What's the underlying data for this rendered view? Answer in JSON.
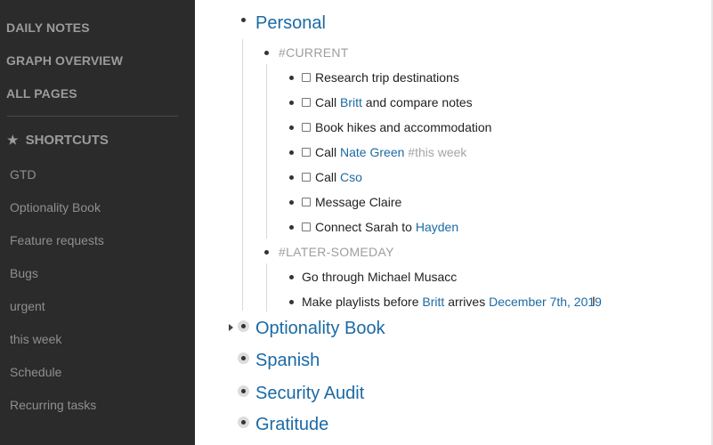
{
  "sidebar": {
    "nav": [
      "DAILY NOTES",
      "GRAPH OVERVIEW",
      "ALL PAGES"
    ],
    "shortcuts_label": "SHORTCUTS",
    "shortcuts": [
      "GTD",
      "Optionality Book",
      "Feature requests",
      "Bugs",
      "urgent",
      "this week",
      "Schedule",
      "Recurring tasks"
    ]
  },
  "outline": {
    "personal": "Personal",
    "current_tag": "#CURRENT",
    "tasks": {
      "t1": "Research trip destinations",
      "t2_pre": "Call",
      "t2_link": "Britt",
      "t2_post": "and compare notes",
      "t3": "Book hikes and accommodation",
      "t4_pre": "Call",
      "t4_link": "Nate Green",
      "t4_tag": "#this week",
      "t5_pre": "Call",
      "t5_link": "Cso",
      "t6": "Message Claire",
      "t7_pre": "Connect Sarah to",
      "t7_link": "Hayden"
    },
    "later_tag": "#LATER-SOMEDAY",
    "later": {
      "l1": "Go through Michael Musacc",
      "l2_pre": "Make playlists before",
      "l2_link": "Britt",
      "l2_mid": "arrives",
      "l2_date": "December 7th, 2019"
    },
    "pages": [
      "Optionality Book",
      "Spanish",
      "Security Audit",
      "Gratitude"
    ]
  },
  "colors": {
    "sidebar_bg": "#2b2b2b",
    "link": "#1b6aa5",
    "tag": "#9e9e9e"
  },
  "icons": [
    "star-icon",
    "checkbox-icon",
    "bullet-icon",
    "caret-right-icon",
    "text-cursor-icon"
  ]
}
